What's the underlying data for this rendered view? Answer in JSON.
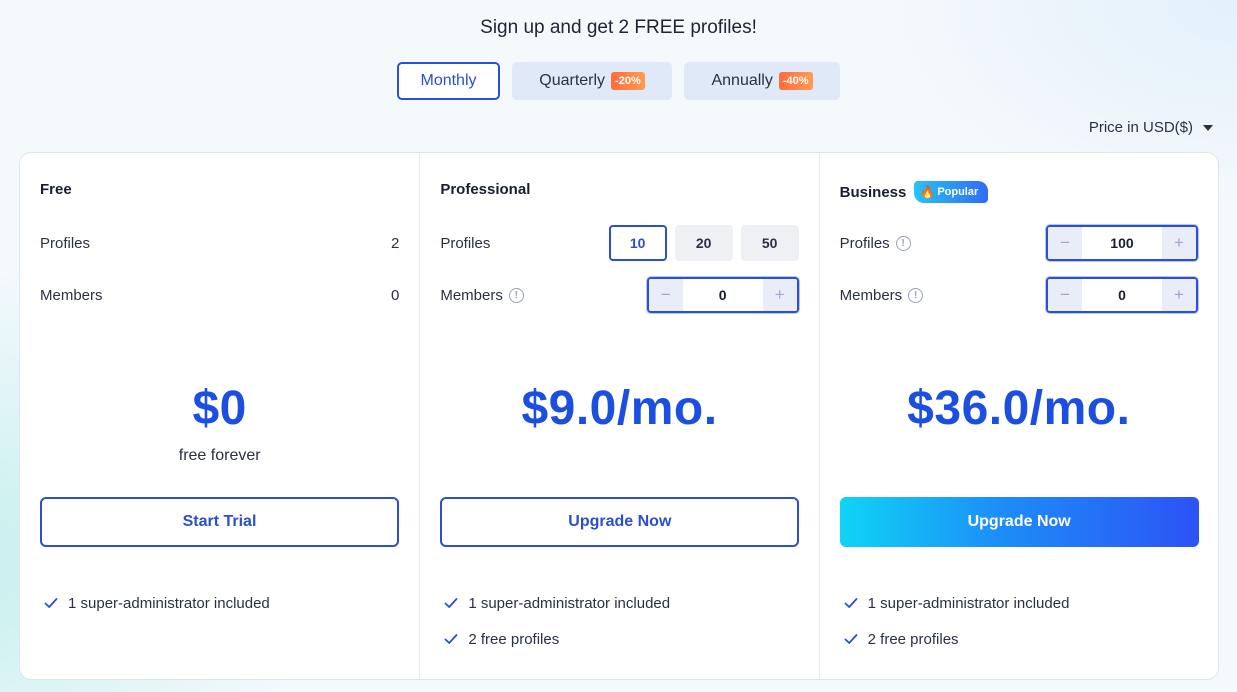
{
  "headline": "Sign up and get 2 FREE profiles!",
  "billing_periods": [
    {
      "label": "Monthly",
      "discount": "",
      "active": true
    },
    {
      "label": "Quarterly",
      "discount": "-20%",
      "active": false
    },
    {
      "label": "Annually",
      "discount": "-40%",
      "active": false
    }
  ],
  "currency": {
    "label": "Price in USD($)",
    "icon": "caret-down-icon"
  },
  "plans": [
    {
      "name": "Free",
      "profiles_label": "Profiles",
      "profiles_value": "2",
      "members_label": "Members",
      "members_value": "0",
      "price": "$0",
      "price_note": "free forever",
      "cta": "Start Trial",
      "features": [
        "1 super-administrator included"
      ]
    },
    {
      "name": "Professional",
      "profiles_label": "Profiles",
      "profile_options": [
        "10",
        "20",
        "50"
      ],
      "selected_profile_option": "10",
      "members_label": "Members",
      "members_value": "0",
      "price": "$9.0/mo.",
      "cta": "Upgrade Now",
      "features": [
        "1 super-administrator included",
        "2 free profiles"
      ]
    },
    {
      "name": "Business",
      "badge": "Popular",
      "profiles_label": "Profiles",
      "profiles_value": "100",
      "members_label": "Members",
      "members_value": "0",
      "price": "$36.0/mo.",
      "cta": "Upgrade Now",
      "features": [
        "1 super-administrator included",
        "2 free profiles"
      ]
    }
  ],
  "stepper": {
    "minus": "−",
    "plus": "+"
  },
  "colors": {
    "accent": "#1c4fe0",
    "cta_gradient_start": "#0fd4f6",
    "cta_gradient_end": "#2d52f5",
    "discount": "#ff7a42"
  }
}
